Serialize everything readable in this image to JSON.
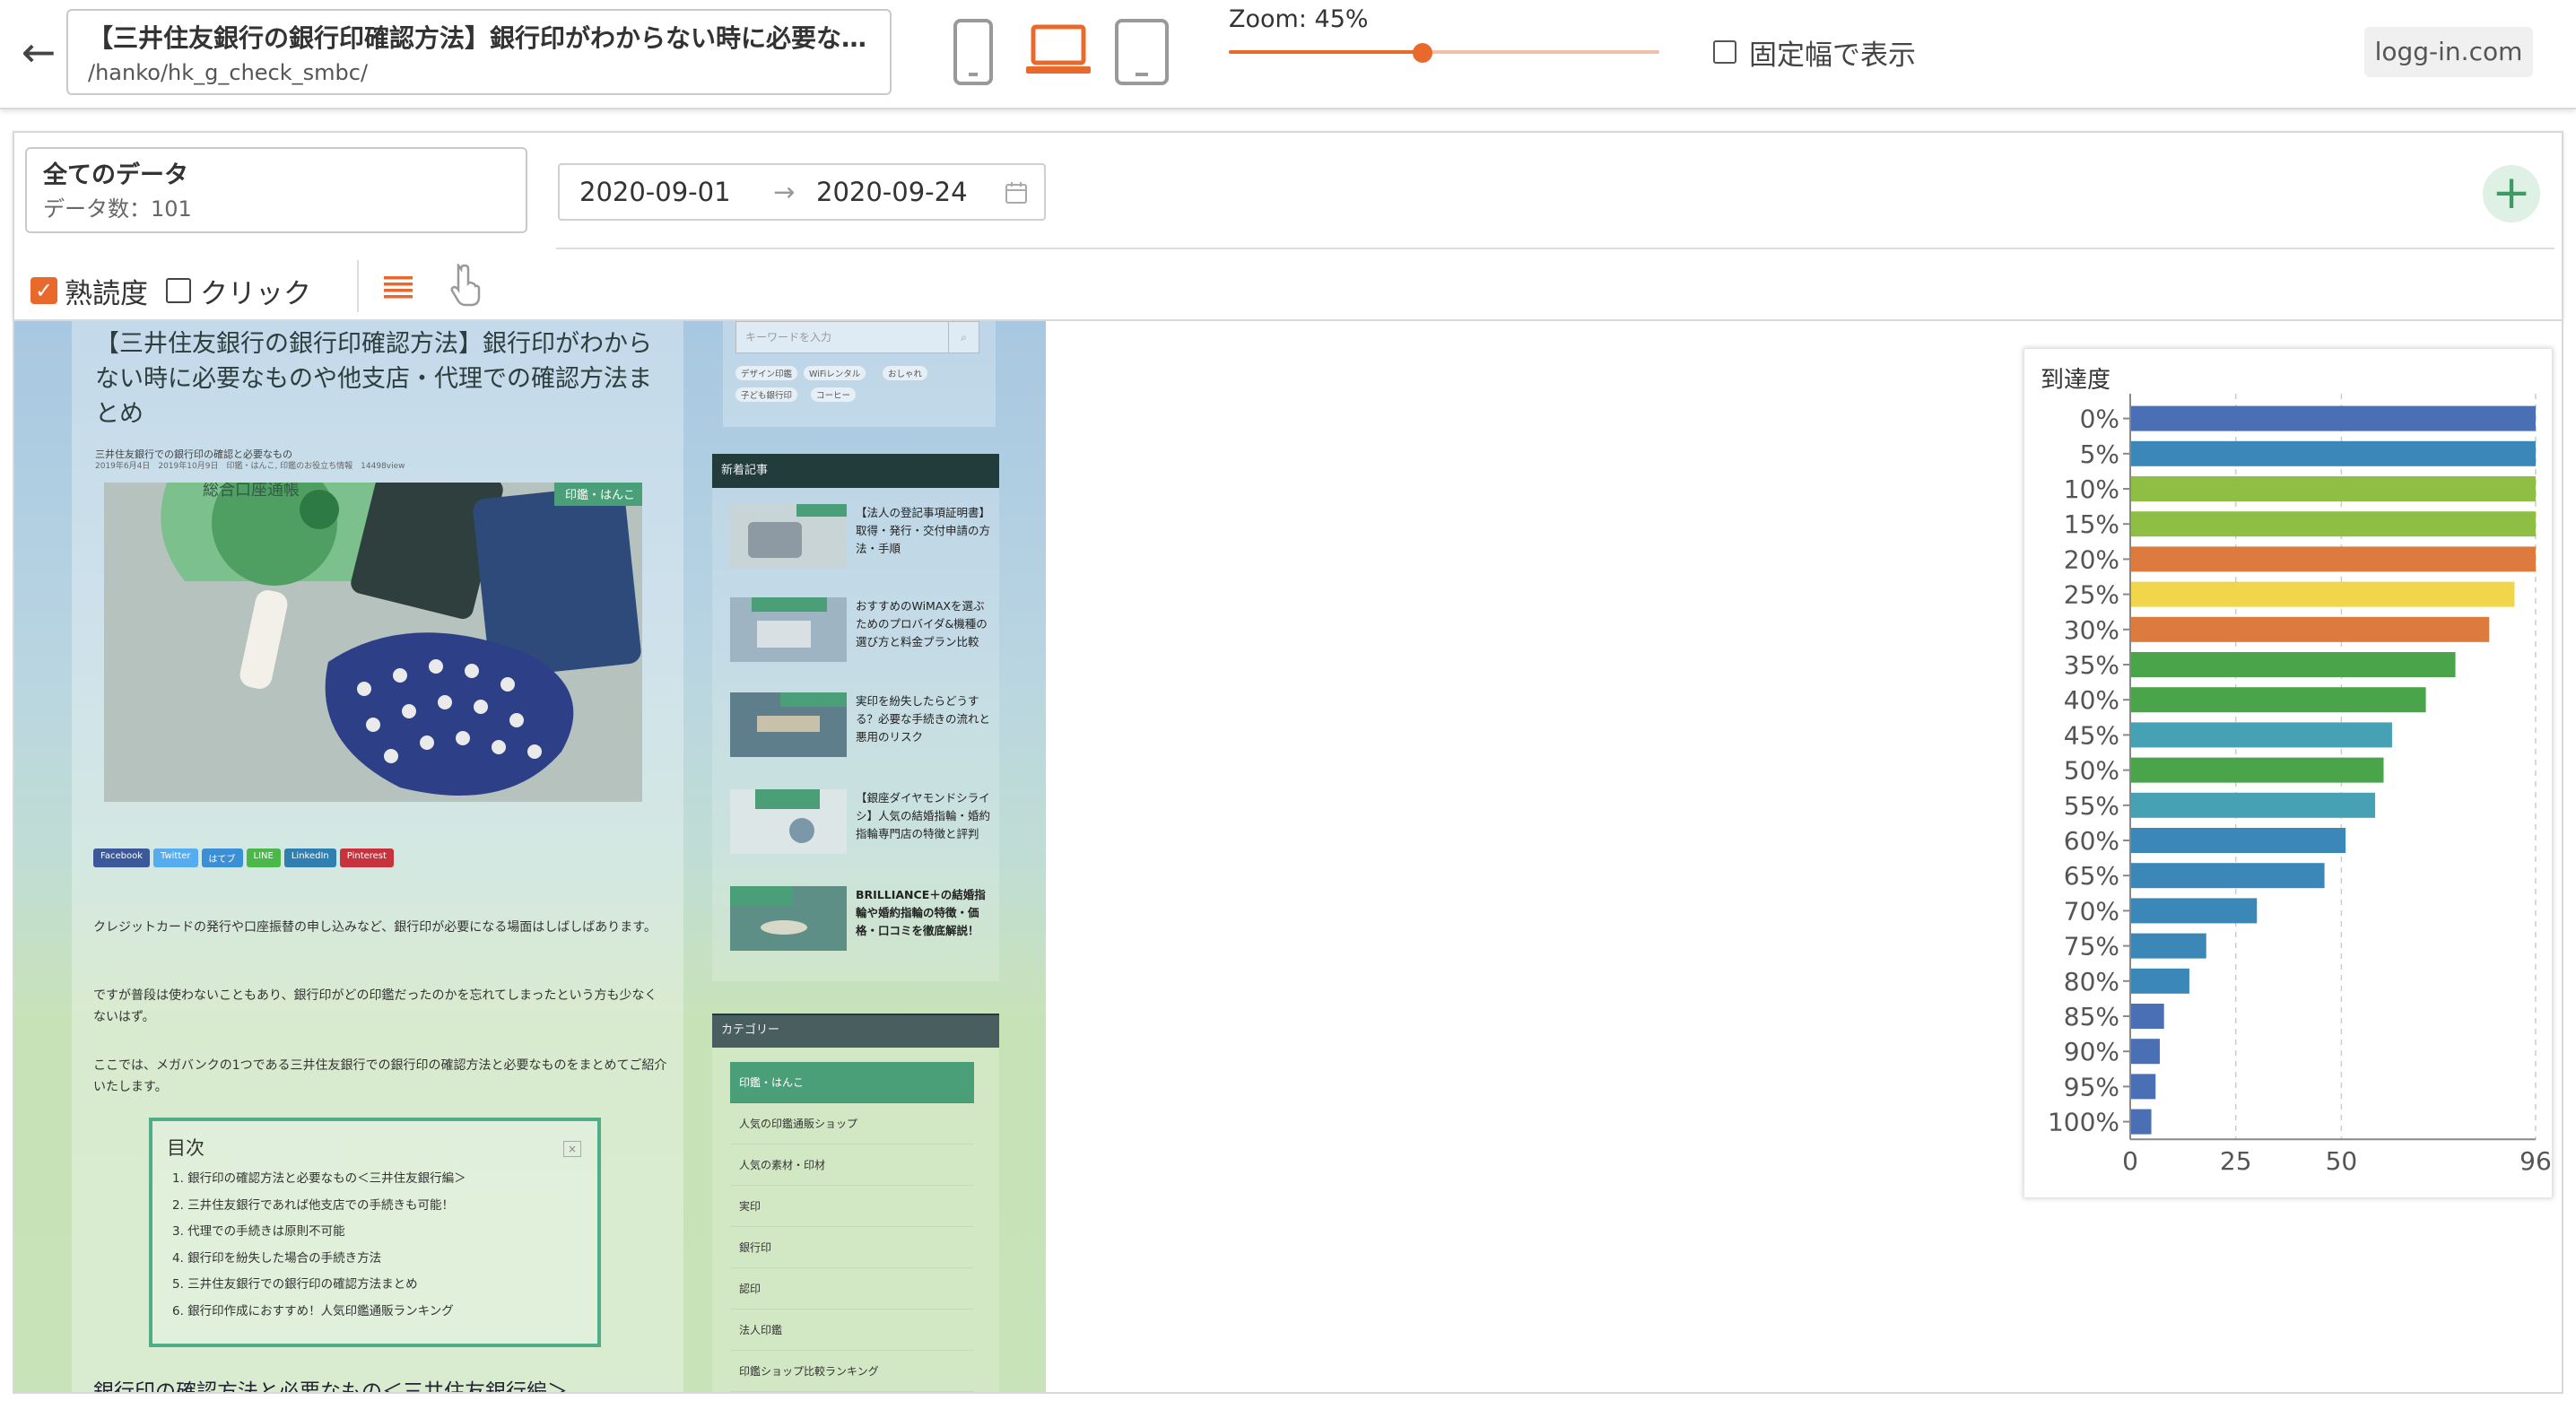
{
  "topbar": {
    "back_icon": "arrow-left-icon",
    "page_title": "【三井住友銀行の銀行印確認方法】銀行印がわからない時に必要なものや他支店・代理での確認方法まとめ",
    "page_url": "/hanko/hk_g_check_smbc/",
    "devices": [
      "smartphone-icon",
      "laptop-icon",
      "tablet-icon"
    ],
    "active_device": "laptop",
    "zoom_label": "Zoom: 45%",
    "zoom_value": 45,
    "fixed_width_label": "固定幅で表示",
    "fixed_width_checked": false,
    "site_name": "logg-in.com",
    "accent_color": "#e8692b"
  },
  "filter": {
    "dataset_name": "全てのデータ",
    "dataset_count": "データ数：101",
    "date_start": "2020-09-01",
    "date_arrow": "→",
    "date_end": "2020-09-24",
    "add_icon": "plus-icon"
  },
  "modes": {
    "heat_label": "熟読度",
    "heat_checked": true,
    "click_label": "クリック",
    "click_checked": false
  },
  "preview": {
    "article_title": "【三井住友銀行の銀行印確認方法】銀行印がわからない時に必要なものや他支店・代理での確認方法まとめ",
    "article_subtitle": "三井住友銀行での銀行印の確認と必要なもの",
    "article_meta": "2019年6月4日　2019年10月9日　印鑑・はんこ, 印鑑のお役立ち情報　14498view",
    "hero_badge": "印鑑・はんこ",
    "hero_sign": "総合口座通帳",
    "share_buttons": [
      "Facebook",
      "Twitter",
      "はてブ",
      "LINE",
      "LinkedIn",
      "Pinterest"
    ],
    "paragraphs": [
      "クレジットカードの発行や口座振替の申し込みなど、銀行印が必要になる場面はしばしばあります。",
      "ですが普段は使わないこともあり、銀行印がどの印鑑だったのかを忘れてしまったという方も少なくないはず。",
      "ここでは、メガバンクの1つである三井住友銀行での銀行印の確認方法と必要なものをまとめてご紹介いたします。"
    ],
    "toc_title": "目次",
    "toc_items": [
      "1. 銀行印の確認方法と必要なもの＜三井住友銀行編＞",
      "2. 三井住友銀行であれば他支店での手続きも可能！",
      "3. 代理での手続きは原則不可能",
      "4. 銀行印を紛失した場合の手続き方法",
      "5. 三井住友銀行での銀行印の確認方法まとめ",
      "6. 銀行印作成におすすめ！人気印鑑通販ランキング"
    ],
    "section_heading": "銀行印の確認方法と必要なもの＜三井住友銀行編＞",
    "search_placeholder": "キーワードを入力",
    "tags": [
      "デザイン印鑑",
      "WiFiレンタル",
      "おしゃれ",
      "子ども銀行印",
      "コーヒー"
    ],
    "new_posts_heading": "新着記事",
    "new_posts": [
      {
        "badge": "印鑑・はんこ",
        "text": "【法人の登記事項証明書】取得・発行・交付申請の方法・手順"
      },
      {
        "badge": "WiMAX・ポケットWiFi",
        "text": "おすすめのWiMAXを選ぶためのプロバイダ&機種の選び方と料金プラン比較"
      },
      {
        "badge": "印鑑・はんこ",
        "text": "実印を紛失したらどうする？必要な手続きの流れと悪用のリスク"
      },
      {
        "badge": "結婚指輪・婚約指輪",
        "text": "【銀座ダイヤモンドシライシ】人気の結婚指輪・婚約指輪専門店の特徴と評判"
      },
      {
        "badge": "結婚指輪・婚約指輪",
        "text": "BRILLIANCE＋の結婚指輪や婚約指輪の特徴・価格・口コミを徹底解説！"
      }
    ],
    "categories_heading": "カテゴリー",
    "categories": [
      "印鑑・はんこ",
      "人気の印鑑通販ショップ",
      "人気の素材・印材",
      "実印",
      "銀行印",
      "認印",
      "法人印鑑",
      "印鑑ショップ比較ランキング"
    ]
  },
  "chart_data": {
    "type": "bar",
    "title": "到達度",
    "categories": [
      "0%",
      "5%",
      "10%",
      "15%",
      "20%",
      "25%",
      "30%",
      "35%",
      "40%",
      "45%",
      "50%",
      "55%",
      "60%",
      "65%",
      "70%",
      "75%",
      "80%",
      "85%",
      "90%",
      "95%",
      "100%"
    ],
    "values": [
      96,
      96,
      96,
      96,
      96,
      91,
      85,
      77,
      70,
      62,
      60,
      58,
      51,
      46,
      30,
      18,
      14,
      8,
      7,
      6,
      5
    ],
    "colors": [
      "#4a6fb5",
      "#3a87b8",
      "#8fbe45",
      "#8fbe45",
      "#dd7a3e",
      "#f1d54a",
      "#dd7a3e",
      "#4aa54a",
      "#4aa54a",
      "#46a1b4",
      "#4aa54a",
      "#46a1b4",
      "#3a87b8",
      "#3a87b8",
      "#3a87b8",
      "#3a87b8",
      "#3a87b8",
      "#4a6fb5",
      "#4a6fb5",
      "#4a6fb5",
      "#4a6fb5"
    ],
    "x_ticks": [
      "0",
      "25",
      "50",
      "96"
    ],
    "xlim": [
      0,
      96
    ],
    "orientation": "horizontal",
    "grid": true
  }
}
